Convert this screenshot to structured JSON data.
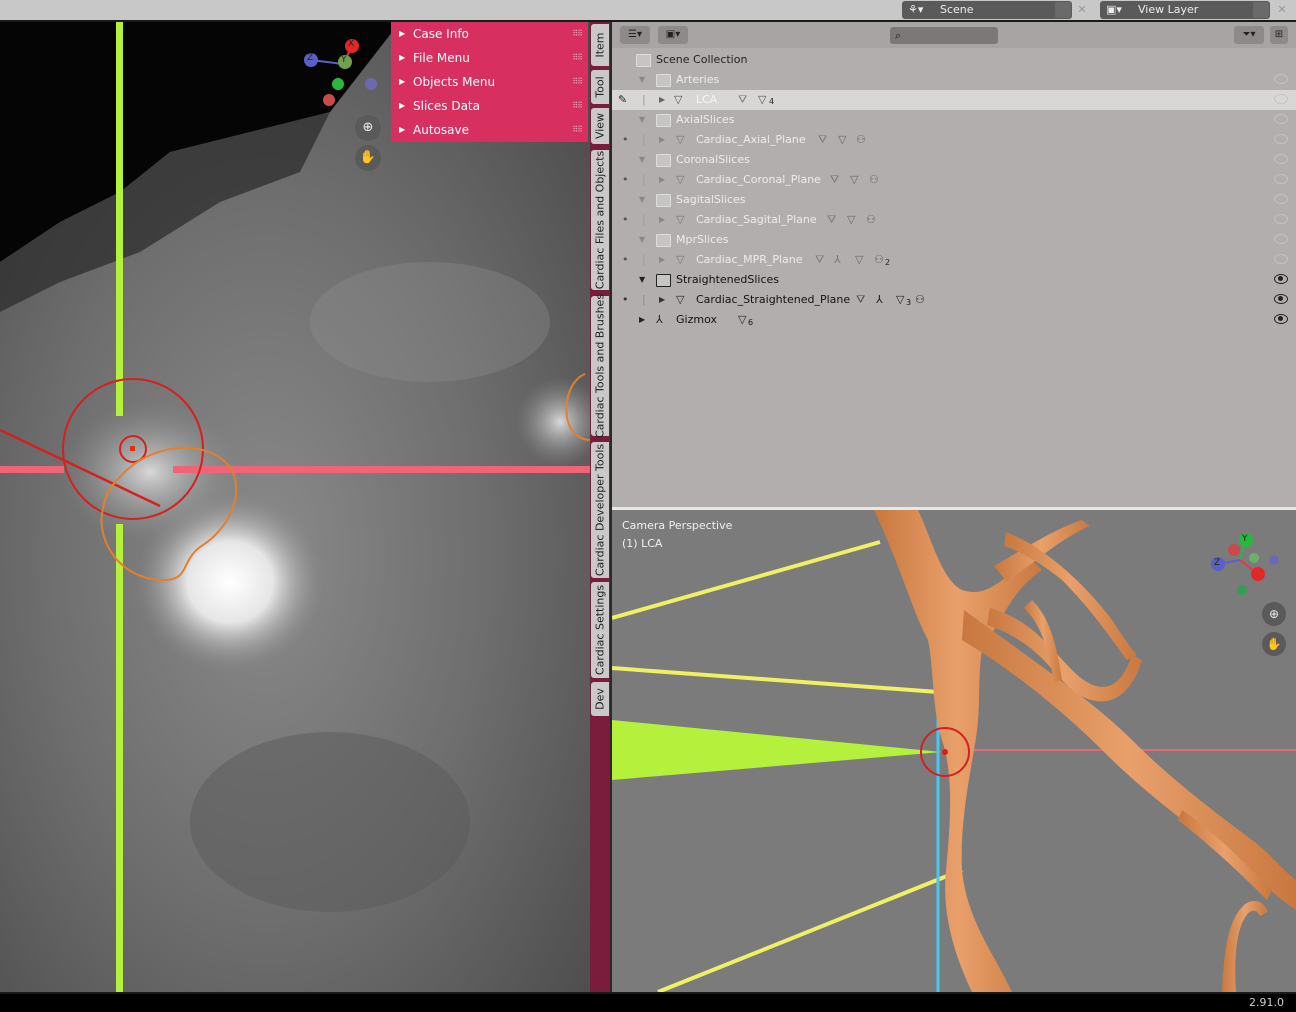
{
  "topbar": {
    "scene_label": "Scene",
    "view_layer_label": "View Layer"
  },
  "n_panel": {
    "items": [
      {
        "label": "Case Info"
      },
      {
        "label": "File Menu"
      },
      {
        "label": "Objects Menu"
      },
      {
        "label": "Slices Data"
      },
      {
        "label": "Autosave"
      }
    ]
  },
  "sidebar_tabs": [
    {
      "label": "Item"
    },
    {
      "label": "Tool"
    },
    {
      "label": "View"
    },
    {
      "label": "Cardiac Files and Objects"
    },
    {
      "label": "Cardiac Tools and Brushes"
    },
    {
      "label": "Cardiac Developer Tools"
    },
    {
      "label": "Cardiac Settings"
    },
    {
      "label": "Dev"
    }
  ],
  "outliner": {
    "search_placeholder": "",
    "rows": [
      {
        "label": "Scene Collection"
      },
      {
        "label": "Arteries"
      },
      {
        "label": "LCA",
        "badge": "4"
      },
      {
        "label": "AxialSlices"
      },
      {
        "label": "Cardiac_Axial_Plane"
      },
      {
        "label": "CoronalSlices"
      },
      {
        "label": "Cardiac_Coronal_Plane"
      },
      {
        "label": "SagitalSlices"
      },
      {
        "label": "Cardiac_Sagital_Plane"
      },
      {
        "label": "MprSlices"
      },
      {
        "label": "Cardiac_MPR_Plane",
        "badge": "2"
      },
      {
        "label": "StraightenedSlices"
      },
      {
        "label": "Cardiac_Straightened_Plane",
        "badge": "3"
      },
      {
        "label": "Gizmox",
        "badge": "6"
      }
    ]
  },
  "viewport_3d": {
    "view_name": "Camera Perspective",
    "active_object": "(1) LCA"
  },
  "gizmo_left": {
    "x": "X",
    "y": "Y",
    "z": "Z"
  },
  "gizmo_right": {
    "y": "Y",
    "z": "Z"
  },
  "status": {
    "version": "2.91.0"
  },
  "colors": {
    "n_panel": "#d73060",
    "tabs_bg": "#7a1c3c",
    "crosshair_green": "#b4f03c",
    "crosshair_pink": "#f06478",
    "vessel": "#e08c55",
    "slice_yellow": "#f0f064",
    "slice_green": "#b4f03c",
    "cyan_line": "#46c8f0"
  }
}
